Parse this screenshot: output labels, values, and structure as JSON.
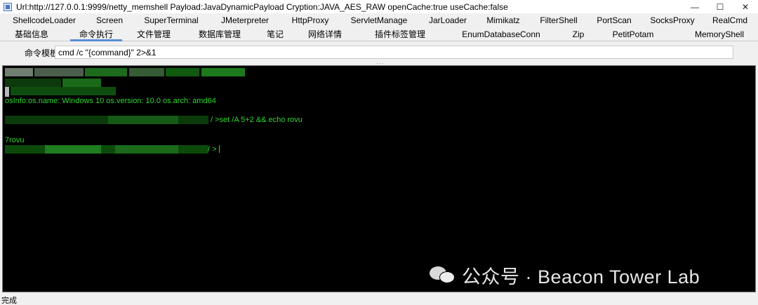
{
  "window": {
    "title": "Url:http://127.0.0.1:9999/netty_memshell Payload:JavaDynamicPayload Cryption:JAVA_AES_RAW openCache:true useCache:false",
    "minimize_glyph": "—",
    "maximize_glyph": "☐",
    "close_glyph": "✕"
  },
  "tabs_row1": [
    "ShellcodeLoader",
    "Screen",
    "SuperTerminal",
    "JMeterpreter",
    "HttpProxy",
    "ServletManage",
    "JarLoader",
    "Mimikatz",
    "FilterShell",
    "PortScan",
    "SocksProxy",
    "RealCmd"
  ],
  "tabs_row2": [
    "基础信息",
    "命令执行",
    "文件管理",
    "数据库管理",
    "笔记",
    "网络详情",
    "插件标签管理",
    "EnumDatabaseConn",
    "Zip",
    "PetitPotam",
    "MemoryShell"
  ],
  "active_tab": "命令执行",
  "command": {
    "label": "命令模板",
    "value": "cmd /c \"{command}\" 2>&1"
  },
  "terminal": {
    "os_info": "osInfo:os.name: Windows 10 os.version: 10.0 os.arch: amd64",
    "command_line": "/ >set /A 5+2 && echo rovu",
    "output": "7rovu",
    "prompt": "/ >"
  },
  "watermark": {
    "text": "公众号 · Beacon Tower Lab"
  },
  "status": {
    "text": "完成"
  },
  "colors": {
    "terminal_bg": "#000000",
    "terminal_text": "#2dd82d",
    "active_tab_underline": "#5b8fd6"
  }
}
